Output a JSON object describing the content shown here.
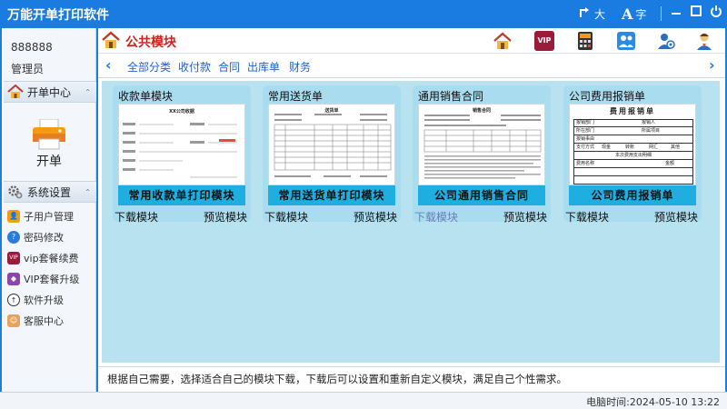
{
  "app": {
    "title": "万能开单打印软件",
    "font_large": "大",
    "font_char": "字",
    "accent": "#1a7be0"
  },
  "sidebar": {
    "user_id": "888888",
    "user_role": "管理员",
    "section_open": "开单中心",
    "open_label": "开单",
    "section_settings": "系统设置",
    "items": [
      {
        "label": "子用户管理",
        "icon": "user-group-icon"
      },
      {
        "label": "密码修改",
        "icon": "help-icon"
      },
      {
        "label": "vip套餐续费",
        "icon": "vip-icon"
      },
      {
        "label": "VIP套餐升级",
        "icon": "diamond-icon"
      },
      {
        "label": "软件升级",
        "icon": "upgrade-icon"
      },
      {
        "label": "客服中心",
        "icon": "support-icon"
      }
    ]
  },
  "header": {
    "title": "公共模块",
    "vip": "VIP"
  },
  "categories": [
    "全部分类",
    "收付款",
    "合同",
    "出库单",
    "财务"
  ],
  "cards": [
    {
      "title": "收款单模块",
      "band": "常用收款单打印模块",
      "doc_head": "XX公司收据",
      "download": "下载模块",
      "preview": "预览模块"
    },
    {
      "title": "常用送货单",
      "band": "常用送货单打印模块",
      "doc_head": "送货单",
      "download": "下载模块",
      "preview": "预览模块"
    },
    {
      "title": "通用销售合同",
      "band": "公司通用销售合同",
      "doc_head": "销售合同",
      "download": "下载模块",
      "preview": "预览模块"
    },
    {
      "title": "公司费用报销单",
      "band": "公司费用报销单",
      "doc_head": "费用报销单",
      "download": "下载模块",
      "preview": "预览模块"
    }
  ],
  "expense_form": {
    "row1": [
      "报销部门",
      "报销人"
    ],
    "row2": [
      "所在部门",
      "所属项目"
    ],
    "row3": [
      "报销事由"
    ],
    "row4": [
      "支付方式",
      "现金",
      "转账",
      "网汇",
      "其他"
    ],
    "row5": [
      "本次费用支出明细"
    ],
    "row6": [
      "费用名称",
      "金额"
    ]
  },
  "footer_note": "根据自己需要，选择适合自己的模块下载，下载后可以设置和重新自定义模块，满足自己个性需求。",
  "status": "电脑时间:2024-05-10 13:22"
}
